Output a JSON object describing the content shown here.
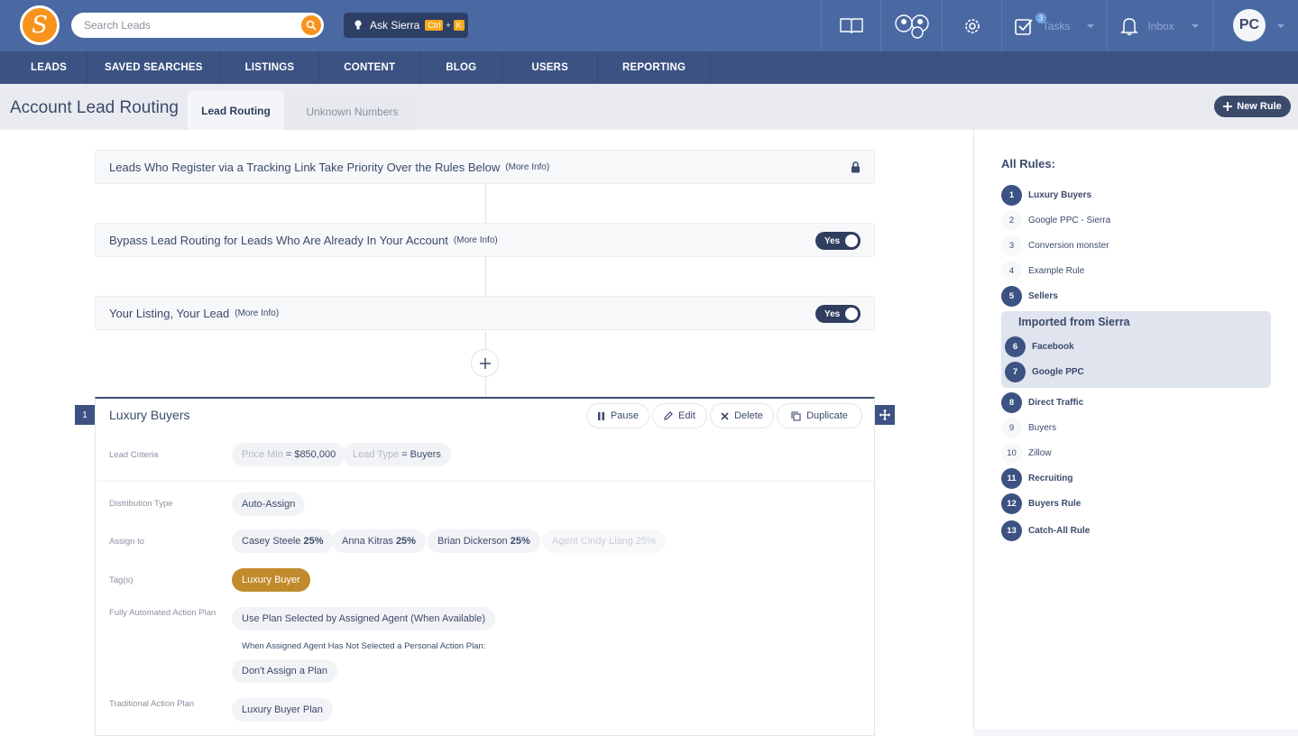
{
  "topbar": {
    "search_placeholder": "Search Leads",
    "ask_label": "Ask Sierra",
    "ask_kbd_ctrl": "Ctrl",
    "ask_kbd_plus": "+",
    "ask_kbd_k": "K",
    "tasks_label": "Tasks",
    "tasks_count": "3",
    "inbox_label": "Inbox",
    "avatar_initials": "PC"
  },
  "nav": [
    "LEADS",
    "SAVED SEARCHES",
    "LISTINGS",
    "CONTENT",
    "BLOG",
    "USERS",
    "REPORTING"
  ],
  "header": {
    "title": "Account Lead Routing",
    "tab_active": "Lead Routing",
    "tab_inactive": "Unknown Numbers",
    "new_rule": "New Rule"
  },
  "preset_rules": [
    {
      "label": "Leads Who Register via a Tracking Link Take Priority Over the Rules Below",
      "info": "(More Info)"
    },
    {
      "label": "Bypass Lead Routing for Leads Who Are Already In Your Account",
      "info": "(More Info)",
      "toggle": "Yes"
    },
    {
      "label": "Your Listing, Your Lead",
      "info": "(More Info)",
      "toggle": "Yes"
    }
  ],
  "rule_card": {
    "number": "1",
    "title": "Luxury Buyers",
    "actions": {
      "pause": "Pause",
      "edit": "Edit",
      "delete": "Delete",
      "duplicate": "Duplicate"
    },
    "lead_criteria_label": "Lead Criteria",
    "criteria": [
      {
        "key": "Price Min",
        "value": "= $850,000"
      },
      {
        "key": "Lead Type",
        "value": "= Buyers"
      }
    ],
    "distribution_label": "Distribution Type",
    "distribution": "Auto-Assign",
    "assign_label": "Assign to",
    "assignees": [
      {
        "name": "Casey Steele",
        "pct": "25%"
      },
      {
        "name": "Anna Kitras",
        "pct": "25%"
      },
      {
        "name": "Brian Dickerson",
        "pct": "25%"
      },
      {
        "name": "Agent Cindy Liang 25%"
      }
    ],
    "tags_label": "Tag(s)",
    "tag": "Luxury Buyer",
    "auto_plan_label": "Fully Automated Action Plan",
    "auto_plan": "Use Plan Selected by Assigned Agent (When Available)",
    "auto_plan_note": "When Assigned Agent Has Not Selected a Personal Action Plan:",
    "auto_plan_fallback": "Don't Assign a Plan",
    "trad_plan_label": "Traditional Action Plan",
    "trad_plan": "Luxury Buyer Plan"
  },
  "sidebar": {
    "title": "All Rules:",
    "group_title": "Imported from Sierra",
    "rules": [
      {
        "n": "1",
        "name": "Luxury Buyers",
        "active": true
      },
      {
        "n": "2",
        "name": "Google PPC - Sierra",
        "active": false
      },
      {
        "n": "3",
        "name": "Conversion monster",
        "active": false
      },
      {
        "n": "4",
        "name": "Example Rule",
        "active": false
      },
      {
        "n": "5",
        "name": "Sellers",
        "active": true
      },
      {
        "n": "6",
        "name": "Facebook",
        "active": true
      },
      {
        "n": "7",
        "name": "Google PPC",
        "active": true
      },
      {
        "n": "8",
        "name": "Direct Traffic",
        "active": true
      },
      {
        "n": "9",
        "name": "Buyers",
        "active": false
      },
      {
        "n": "10",
        "name": "Zillow",
        "active": false
      },
      {
        "n": "11",
        "name": "Recruiting",
        "active": true
      },
      {
        "n": "12",
        "name": "Buyers Rule",
        "active": true
      },
      {
        "n": "13",
        "name": "Catch-All Rule",
        "active": true
      }
    ]
  },
  "colors": {
    "topbar": "#4a69a3",
    "nav": "#3b5283",
    "accent_orange": "#f7941d",
    "tag_gold": "#c18a2c",
    "dark": "#3b4a6b"
  }
}
